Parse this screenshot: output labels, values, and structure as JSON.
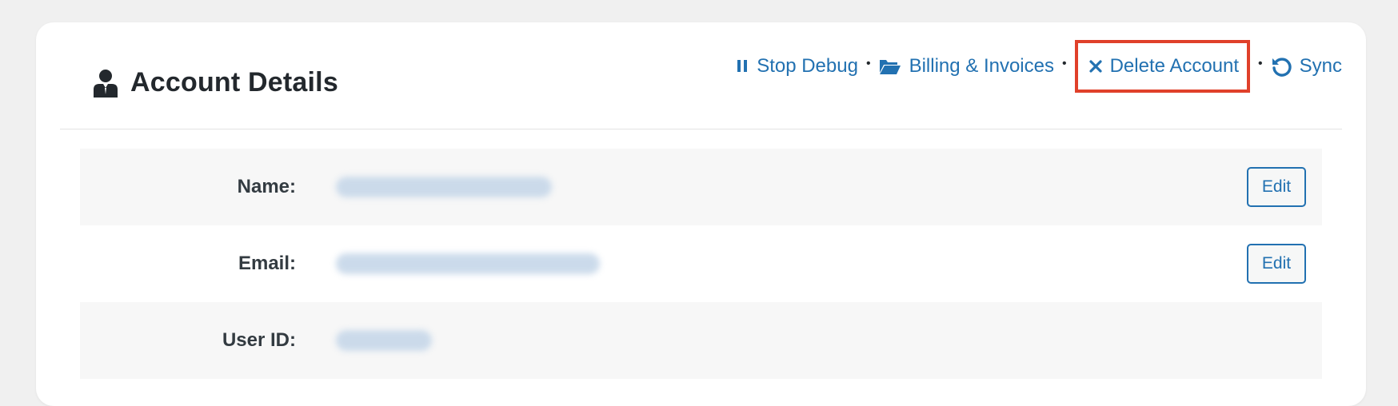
{
  "header": {
    "title": "Account Details",
    "title_icon": "user-icon"
  },
  "actions": [
    {
      "label": "Stop Debug",
      "icon": "pause-icon"
    },
    {
      "label": "Billing & Invoices",
      "icon": "folder-open-icon"
    },
    {
      "label": "Delete Account",
      "icon": "close-icon",
      "highlighted": true
    },
    {
      "label": "Sync",
      "icon": "sync-icon"
    }
  ],
  "separator": "•",
  "fields": [
    {
      "label": "Name:",
      "edit_label": "Edit"
    },
    {
      "label": "Email:",
      "edit_label": "Edit"
    },
    {
      "label": "User ID:"
    }
  ],
  "colors": {
    "link": "#2271b1",
    "highlight_border": "#e0402a",
    "row_shade": "#f7f7f7"
  }
}
